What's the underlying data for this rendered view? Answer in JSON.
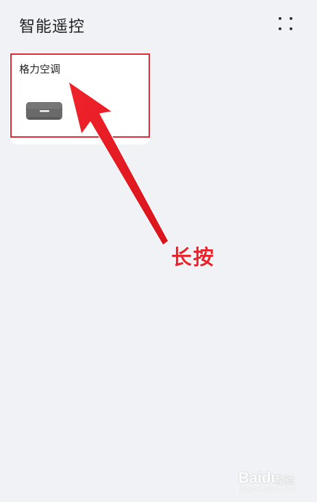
{
  "header": {
    "title": "智能遥控",
    "more_icon": "grid-dots-icon"
  },
  "devices": [
    {
      "label": "格力空调",
      "icon": "air-conditioner-icon"
    }
  ],
  "annotation": {
    "text": "长按",
    "color": "#e8262f"
  },
  "watermark": {
    "brand": "Baidu",
    "sub": "经验",
    "url": "jingyan.baidu.com"
  },
  "colors": {
    "background": "#f1f2f5",
    "card": "#ffffff",
    "highlight": "#e02731",
    "arrow": "#ec1c24"
  }
}
